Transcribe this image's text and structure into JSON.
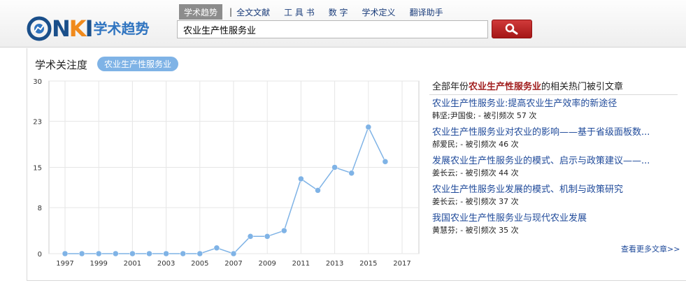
{
  "header": {
    "logo_text": "CNKI",
    "logo_sub": "学术趋势",
    "nav": {
      "active": "学术趋势",
      "separator": "|",
      "items": [
        "全文文献",
        "工 具 书",
        "数  字",
        "学术定义",
        "翻译助手"
      ]
    },
    "search": {
      "value": "农业生产性服务业",
      "button_icon": "search-icon"
    }
  },
  "section": {
    "title": "学术关注度",
    "tag": "农业生产性服务业"
  },
  "chart_data": {
    "type": "line",
    "x": [
      1997,
      1998,
      1999,
      2000,
      2001,
      2002,
      2003,
      2004,
      2005,
      2006,
      2007,
      2008,
      2009,
      2010,
      2011,
      2012,
      2013,
      2014,
      2015,
      2016
    ],
    "values": [
      0,
      0,
      0,
      0,
      0,
      0,
      0,
      0,
      0,
      1,
      0,
      3,
      3,
      4,
      13,
      11,
      15,
      14,
      22,
      16
    ],
    "x_ticks": [
      "1997",
      "1999",
      "2001",
      "2003",
      "2005",
      "2007",
      "2009",
      "2011",
      "2013",
      "2015",
      "2017"
    ],
    "y_ticks": [
      "0",
      "8",
      "15",
      "23",
      "30"
    ],
    "ylim": [
      0,
      30
    ],
    "xlim": [
      1997,
      2017
    ],
    "grid": true,
    "color": "#7fb3e6"
  },
  "hot_articles": {
    "title_prefix": "全部年份",
    "title_keyword": "农业生产性服务业",
    "title_suffix": "的相关热门被引文章",
    "items": [
      {
        "title": "农业生产性服务业:提高农业生产效率的新途径",
        "meta": "韩坚;尹国俊;  -  被引频次 57 次"
      },
      {
        "title": "农业生产性服务业对农业的影响——基于省级面板数...",
        "meta": "郝爱民;  -  被引频次 46 次"
      },
      {
        "title": "发展农业生产性服务业的模式、启示与政策建议——...",
        "meta": "姜长云;  -  被引频次 44 次"
      },
      {
        "title": "农业生产性服务业发展的模式、机制与政策研究",
        "meta": "姜长云;  -  被引频次 37 次"
      },
      {
        "title": "我国农业生产性服务业与现代农业发展",
        "meta": "黄慧芬;  -  被引频次 35 次"
      }
    ],
    "more": "查看更多文章>>"
  }
}
